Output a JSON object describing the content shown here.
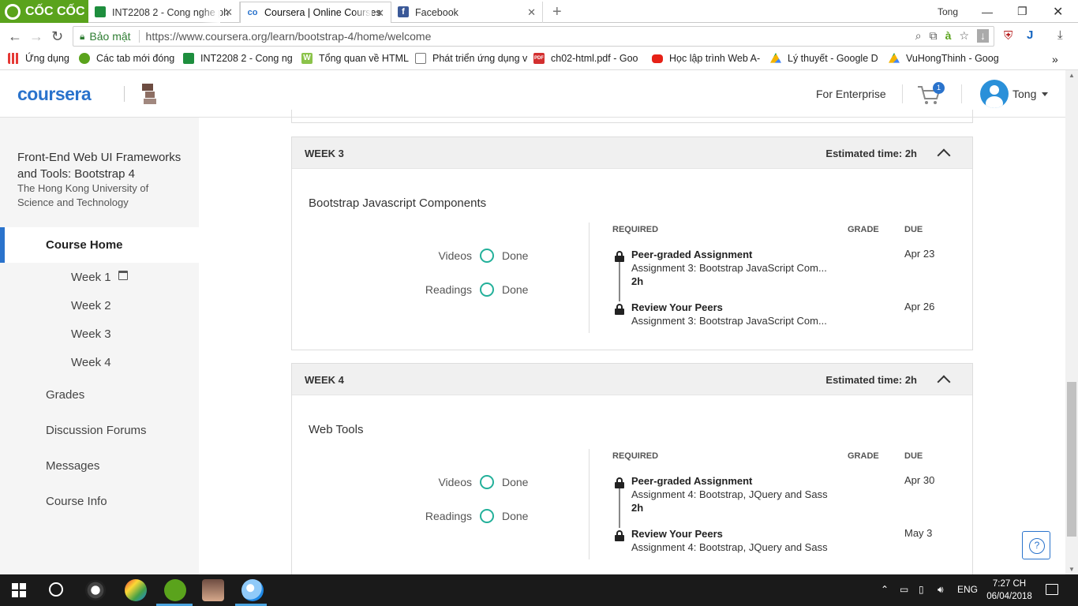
{
  "browser": {
    "brand": "CỐC CỐC",
    "tabs": [
      {
        "label": "INT2208 2 - Cong nghe ph",
        "color": "#1e8e3e",
        "active": false
      },
      {
        "label": "Coursera | Online Courses",
        "color": "#2a73cc",
        "active": true
      },
      {
        "label": "Facebook",
        "color": "#3b5998",
        "active": false
      }
    ],
    "user_label": "Tong",
    "security_label": "Bảo mật",
    "url": "https://www.coursera.org/learn/bootstrap-4/home/welcome",
    "bookmarks": [
      {
        "label": "Ứng dụng",
        "icon": "apps-grid-icon",
        "color": "#e53935"
      },
      {
        "label": "Các tab mới đóng",
        "icon": "coccoc-icon",
        "color": "#5aa31c"
      },
      {
        "label": "INT2208 2 - Cong ng",
        "icon": "sheets-icon",
        "color": "#1e8e3e"
      },
      {
        "label": "Tổng quan về HTML",
        "icon": "w-icon",
        "color": "#8bc34a"
      },
      {
        "label": "Phát triển ứng dụng v",
        "icon": "page-icon",
        "color": "#9e9e9e"
      },
      {
        "label": "ch02-html.pdf - Goo",
        "icon": "pdf-icon",
        "color": "#d32f2f"
      },
      {
        "label": "Học lập trình Web A-",
        "icon": "youtube-icon",
        "color": "#e62117"
      },
      {
        "label": "Lý thuyết - Google D",
        "icon": "drive-icon",
        "color": "#f4b400"
      },
      {
        "label": "VuHongThinh - Goog",
        "icon": "drive-icon",
        "color": "#f4b400"
      }
    ]
  },
  "header": {
    "logo": "coursera",
    "enterprise": "For Enterprise",
    "cart_count": "1",
    "username": "Tong"
  },
  "sidebar": {
    "course_title": "Front-End Web UI Frameworks and Tools: Bootstrap 4",
    "institution": "The Hong Kong University of Science and Technology",
    "active_item": "Course Home",
    "weeks": [
      "Week 1",
      "Week 2",
      "Week 3",
      "Week 4"
    ],
    "items": [
      "Grades",
      "Discussion Forums",
      "Messages",
      "Course Info"
    ]
  },
  "weeks": [
    {
      "label": "WEEK 3",
      "estimate": "Estimated time: 2h",
      "lesson": "Bootstrap Javascript Components",
      "progress": [
        {
          "label": "Videos",
          "status": "Done"
        },
        {
          "label": "Readings",
          "status": "Done"
        }
      ],
      "headers": {
        "required": "REQUIRED",
        "grade": "GRADE",
        "due": "DUE"
      },
      "items": [
        {
          "title": "Peer-graded Assignment",
          "subtitle": "Assignment 3: Bootstrap JavaScript Com...",
          "hours": "2h",
          "due": "Apr 23"
        },
        {
          "title": "Review Your Peers",
          "subtitle": "Assignment 3: Bootstrap JavaScript Com...",
          "hours": "",
          "due": "Apr 26"
        }
      ]
    },
    {
      "label": "WEEK 4",
      "estimate": "Estimated time: 2h",
      "lesson": "Web Tools",
      "progress": [
        {
          "label": "Videos",
          "status": "Done"
        },
        {
          "label": "Readings",
          "status": "Done"
        }
      ],
      "headers": {
        "required": "REQUIRED",
        "grade": "GRADE",
        "due": "DUE"
      },
      "items": [
        {
          "title": "Peer-graded Assignment",
          "subtitle": "Assignment 4: Bootstrap, JQuery and Sass",
          "hours": "2h",
          "due": "Apr 30"
        },
        {
          "title": "Review Your Peers",
          "subtitle": "Assignment 4: Bootstrap, JQuery and Sass",
          "hours": "",
          "due": "May 3"
        }
      ]
    }
  ],
  "help": "?",
  "taskbar": {
    "language": "ENG",
    "time": "7:27 CH",
    "date": "06/04/2018"
  },
  "colors": {
    "accent": "#2a73cc",
    "done_ring": "#23b09a",
    "brand_green": "#5aa31c"
  }
}
